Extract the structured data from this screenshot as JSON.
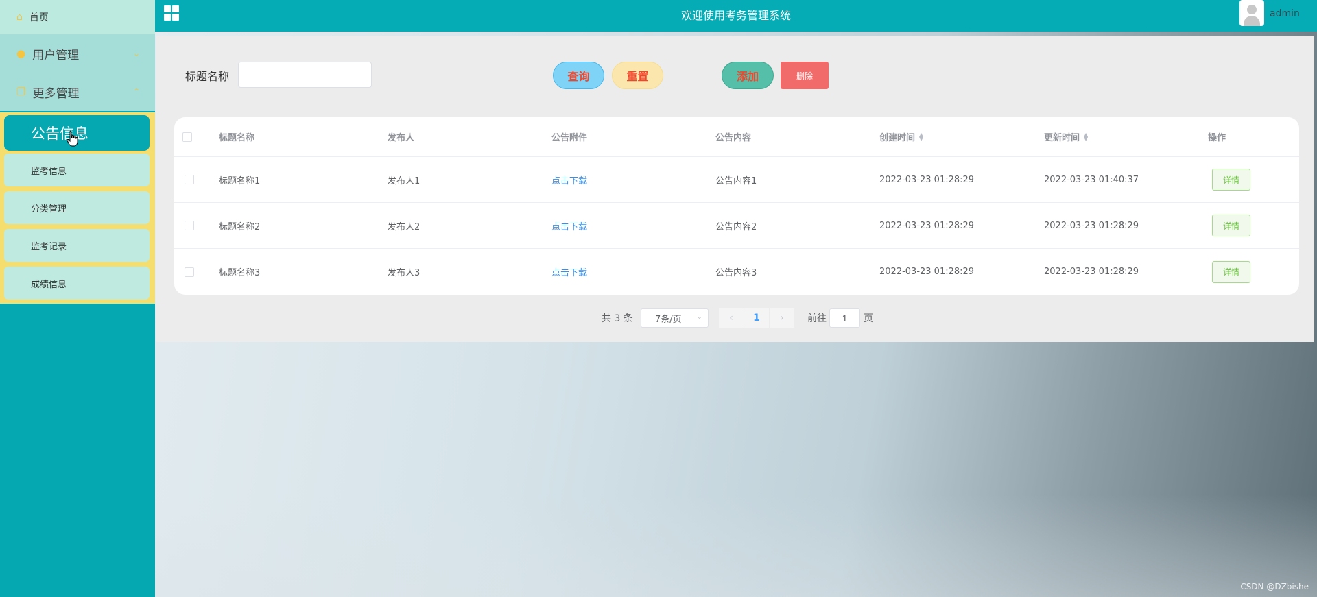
{
  "header": {
    "title": "欢迎使用考务管理系统",
    "username": "admin"
  },
  "sidebar": {
    "home": "首页",
    "groups": [
      {
        "label": "用户管理",
        "expanded": false
      },
      {
        "label": "更多管理",
        "expanded": true
      }
    ],
    "submenu": [
      "公告信息",
      "监考信息",
      "分类管理",
      "监考记录",
      "成绩信息"
    ],
    "active_index": 0
  },
  "search": {
    "label": "标题名称",
    "value": "",
    "placeholder": ""
  },
  "toolbar": {
    "query": "查询",
    "reset": "重置",
    "add": "添加",
    "delete": "删除"
  },
  "table": {
    "columns": [
      "标题名称",
      "发布人",
      "公告附件",
      "公告内容",
      "创建时间",
      "更新时间",
      "操作"
    ],
    "rows": [
      {
        "title": "标题名称1",
        "publisher": "发布人1",
        "attachment": "点击下载",
        "content": "公告内容1",
        "created": "2022-03-23 01:28:29",
        "updated": "2022-03-23 01:40:37",
        "action": "详情"
      },
      {
        "title": "标题名称2",
        "publisher": "发布人2",
        "attachment": "点击下载",
        "content": "公告内容2",
        "created": "2022-03-23 01:28:29",
        "updated": "2022-03-23 01:28:29",
        "action": "详情"
      },
      {
        "title": "标题名称3",
        "publisher": "发布人3",
        "attachment": "点击下载",
        "content": "公告内容3",
        "created": "2022-03-23 01:28:29",
        "updated": "2022-03-23 01:28:29",
        "action": "详情"
      }
    ]
  },
  "pagination": {
    "total": "共 3 条",
    "page_size": "7条/页",
    "current_page": "1",
    "goto_label": "前往",
    "goto_value": "1",
    "goto_suffix": "页"
  },
  "watermark": "CSDN @DZbishe",
  "colors": {
    "primary": "#05acb6",
    "sidebar_item": "#bdeade",
    "submenu_bg": "#f6de6e",
    "danger": "#f26b6b",
    "link": "#3a8ee6"
  }
}
